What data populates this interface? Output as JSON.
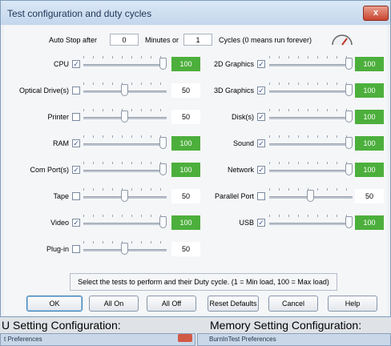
{
  "window": {
    "title": "Test configuration and duty cycles",
    "close_label": "x"
  },
  "autostop": {
    "label": "Auto Stop after",
    "minutes_value": "0",
    "minutes_label": "Minutes or",
    "cycles_value": "1",
    "cycles_label": "Cycles (0 means run forever)"
  },
  "left_tests": [
    {
      "name": "CPU",
      "checked": true,
      "value": "100"
    },
    {
      "name": "Optical Drive(s)",
      "checked": false,
      "value": "50"
    },
    {
      "name": "Printer",
      "checked": false,
      "value": "50"
    },
    {
      "name": "RAM",
      "checked": true,
      "value": "100"
    },
    {
      "name": "Com Port(s)",
      "checked": true,
      "value": "100"
    },
    {
      "name": "Tape",
      "checked": false,
      "value": "50"
    },
    {
      "name": "Video",
      "checked": true,
      "value": "100"
    },
    {
      "name": "Plug-in",
      "checked": false,
      "value": "50"
    }
  ],
  "right_tests": [
    {
      "name": "2D Graphics",
      "checked": true,
      "value": "100"
    },
    {
      "name": "3D Graphics",
      "checked": true,
      "value": "100"
    },
    {
      "name": "Disk(s)",
      "checked": true,
      "value": "100"
    },
    {
      "name": "Sound",
      "checked": true,
      "value": "100"
    },
    {
      "name": "Network",
      "checked": true,
      "value": "100"
    },
    {
      "name": "Parallel Port",
      "checked": false,
      "value": "50"
    },
    {
      "name": "USB",
      "checked": true,
      "value": "100"
    }
  ],
  "status_text": "Select the tests to perform and their Duty cycle. (1 = Min load, 100 = Max load)",
  "buttons": {
    "ok": "OK",
    "all_on": "All On",
    "all_off": "All Off",
    "reset": "Reset Defaults",
    "cancel": "Cancel",
    "help": "Help"
  },
  "background": {
    "left_caption": "U Setting Configuration:",
    "right_caption": "Memory Setting Configuration:",
    "left_window_title": "t Preferences",
    "right_window_title": "BurnInTest Preferences"
  },
  "colors": {
    "active_value": "#4caf3c",
    "title_text": "#1e3557"
  }
}
